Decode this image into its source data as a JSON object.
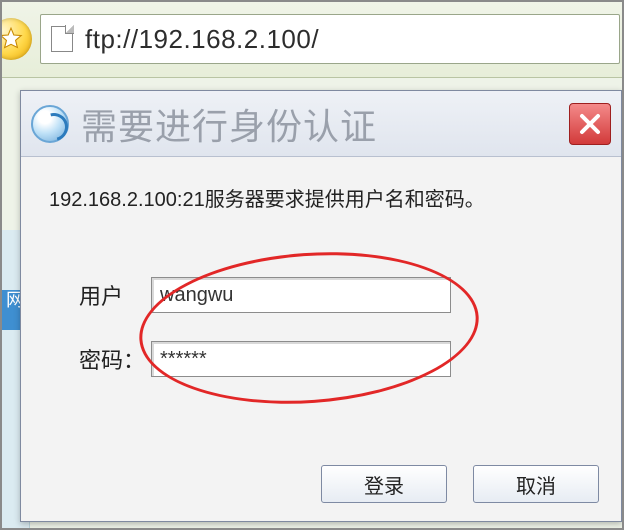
{
  "browser": {
    "url": "ftp://192.168.2.100/"
  },
  "dialog": {
    "title": "需要进行身份认证",
    "message": "192.168.2.100:21服务器要求提供用户名和密码。",
    "labels": {
      "user": "用户",
      "password": "密码："
    },
    "values": {
      "user": "wangwu",
      "password": "******"
    },
    "buttons": {
      "login": "登录",
      "cancel": "取消"
    }
  },
  "bg_text": "网"
}
